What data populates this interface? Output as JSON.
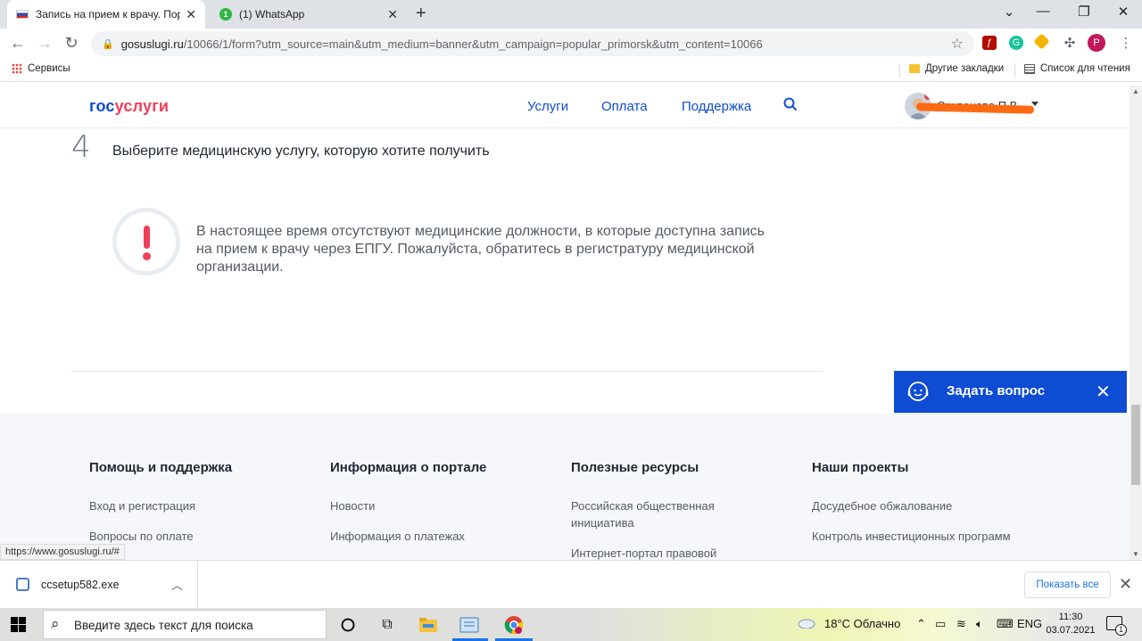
{
  "browser": {
    "tabs": [
      {
        "title": "Запись на прием к врачу. Порт",
        "active": true
      },
      {
        "title": "(1) WhatsApp",
        "badge": "1",
        "active": false
      }
    ],
    "new_tab": "+",
    "address": {
      "host": "gosuslugi.ru",
      "path": "/10066/1/form?utm_source=main&utm_medium=banner&utm_campaign=popular_primorsk&utm_content=10066"
    },
    "profile_letter": "P",
    "bookmarks": {
      "apps": "Сервисы",
      "other": "Другие закладки",
      "reading_list": "Список для чтения"
    }
  },
  "header": {
    "logo_a": "гос",
    "logo_b": "услуги",
    "nav": [
      "Услуги",
      "Оплата",
      "Поддержка"
    ],
    "user_name": "Степанова П.В."
  },
  "main": {
    "step_number": "4",
    "step_title": "Выберите медицинскую услугу, которую хотите получить",
    "warning": "В настоящее время отсутствуют медицинские должности, в которые доступна запись на прием к врачу через ЕПГУ. Пожалуйста, обратитесь в регистратуру медицинской организации."
  },
  "ask_widget": {
    "label": "Задать вопрос"
  },
  "footer": {
    "columns": [
      {
        "title": "Помощь и поддержка",
        "links": [
          "Вход и регистрация",
          "Вопросы по оплате"
        ]
      },
      {
        "title": "Информация о портале",
        "links": [
          "Новости",
          "Информация о платежах"
        ]
      },
      {
        "title": "Полезные ресурсы",
        "links": [
          "Российская общественная инициатива",
          "Интернет-портал правовой"
        ]
      },
      {
        "title": "Наши проекты",
        "links": [
          "Досудебное обжалование",
          "Контроль инвестиционных программ"
        ]
      }
    ]
  },
  "status_url": "https://www.gosuslugi.ru/#",
  "download": {
    "filename": "ccsetup582.exe",
    "show_all": "Показать все"
  },
  "taskbar": {
    "search_placeholder": "Введите здесь текст для поиска",
    "weather": "18°C  Облачно",
    "lang": "ENG",
    "time": "11:30",
    "date": "03.07.2021",
    "notification_count": "1"
  },
  "colors": {
    "brand_blue": "#0d4cd3",
    "brand_red": "#ee3f58",
    "redaction": "#ff6a13"
  }
}
